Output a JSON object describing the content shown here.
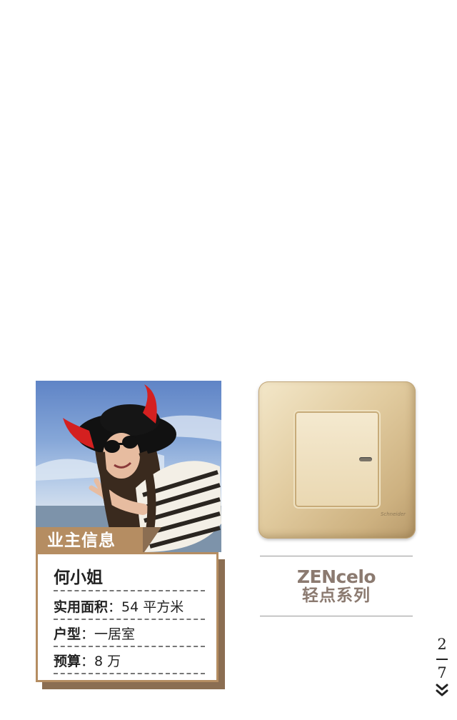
{
  "owner_card": {
    "badge_label": "业主信息",
    "name": "何小姐",
    "area": {
      "key": "实用面积",
      "value": "54 平方米"
    },
    "layout": {
      "key": "户型",
      "value": "一居室"
    },
    "budget": {
      "key": "预算",
      "value": "8 万"
    },
    "separator": "："
  },
  "product": {
    "series_en": "ZENcelo",
    "series_cn": "轻点系列",
    "brand_mark": "Schneider"
  },
  "pagination": {
    "current": "2",
    "total": "7"
  },
  "colors": {
    "badge": "#b58d62",
    "badge_dark": "#8b6e52",
    "series_text": "#8b7a70",
    "switch_gold": "#e1cb9f"
  },
  "icons": {
    "scroll_down": "double-chevron-down-icon"
  }
}
